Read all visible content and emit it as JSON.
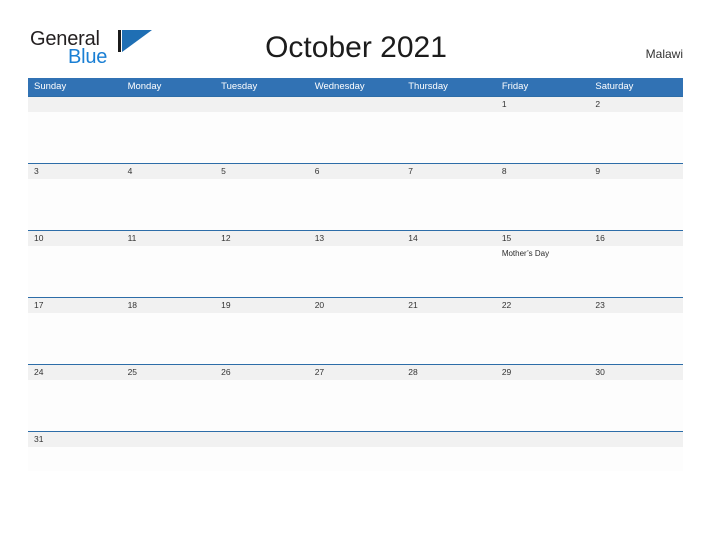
{
  "brand": {
    "name_part1": "General",
    "name_part2": "Blue",
    "mark": "triangle-logo"
  },
  "header": {
    "title": "October 2021",
    "country": "Malawi"
  },
  "colors": {
    "header_blue": "#3172b4",
    "rule_blue": "#2d6da8",
    "date_band": "#f1f1f1",
    "brand_blue": "#1a7fd4",
    "text_dark": "#333333"
  },
  "calendar": {
    "day_headers": [
      "Sunday",
      "Monday",
      "Tuesday",
      "Wednesday",
      "Thursday",
      "Friday",
      "Saturday"
    ],
    "weeks": [
      {
        "dates": [
          "",
          "",
          "",
          "",
          "",
          "1",
          "2"
        ],
        "events": [
          "",
          "",
          "",
          "",
          "",
          "",
          ""
        ]
      },
      {
        "dates": [
          "3",
          "4",
          "5",
          "6",
          "7",
          "8",
          "9"
        ],
        "events": [
          "",
          "",
          "",
          "",
          "",
          "",
          ""
        ]
      },
      {
        "dates": [
          "10",
          "11",
          "12",
          "13",
          "14",
          "15",
          "16"
        ],
        "events": [
          "",
          "",
          "",
          "",
          "",
          "Mother’s Day",
          ""
        ]
      },
      {
        "dates": [
          "17",
          "18",
          "19",
          "20",
          "21",
          "22",
          "23"
        ],
        "events": [
          "",
          "",
          "",
          "",
          "",
          "",
          ""
        ]
      },
      {
        "dates": [
          "24",
          "25",
          "26",
          "27",
          "28",
          "29",
          "30"
        ],
        "events": [
          "",
          "",
          "",
          "",
          "",
          "",
          ""
        ]
      },
      {
        "dates": [
          "31",
          "",
          "",
          "",
          "",
          "",
          ""
        ],
        "events": [
          "",
          "",
          "",
          "",
          "",
          "",
          ""
        ]
      }
    ]
  }
}
